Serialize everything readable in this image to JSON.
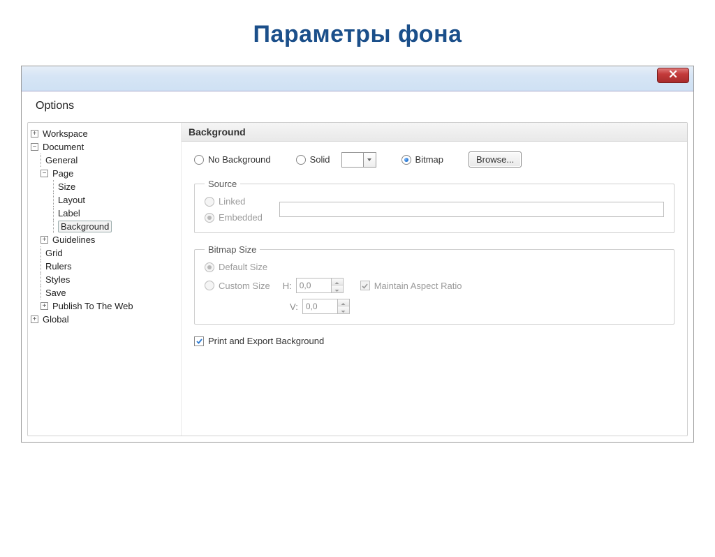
{
  "slide_title": "Параметры фона",
  "window_title": "Options",
  "tree": {
    "workspace": "Workspace",
    "document": "Document",
    "general": "General",
    "page": "Page",
    "size": "Size",
    "layout": "Layout",
    "label": "Label",
    "background": "Background",
    "guidelines": "Guidelines",
    "grid": "Grid",
    "rulers": "Rulers",
    "styles": "Styles",
    "save": "Save",
    "publish": "Publish To The Web",
    "global": "Global"
  },
  "panel": {
    "header": "Background",
    "radios": {
      "no_bg": "No Background",
      "solid": "Solid",
      "bitmap": "Bitmap"
    },
    "browse": "Browse...",
    "source": {
      "legend": "Source",
      "linked": "Linked",
      "embedded": "Embedded",
      "path": ""
    },
    "bitmap_size": {
      "legend": "Bitmap Size",
      "default": "Default Size",
      "custom": "Custom Size",
      "h_label": "H:",
      "v_label": "V:",
      "h_value": "0,0",
      "v_value": "0,0",
      "aspect": "Maintain Aspect Ratio"
    },
    "print_export": "Print and Export Background"
  }
}
